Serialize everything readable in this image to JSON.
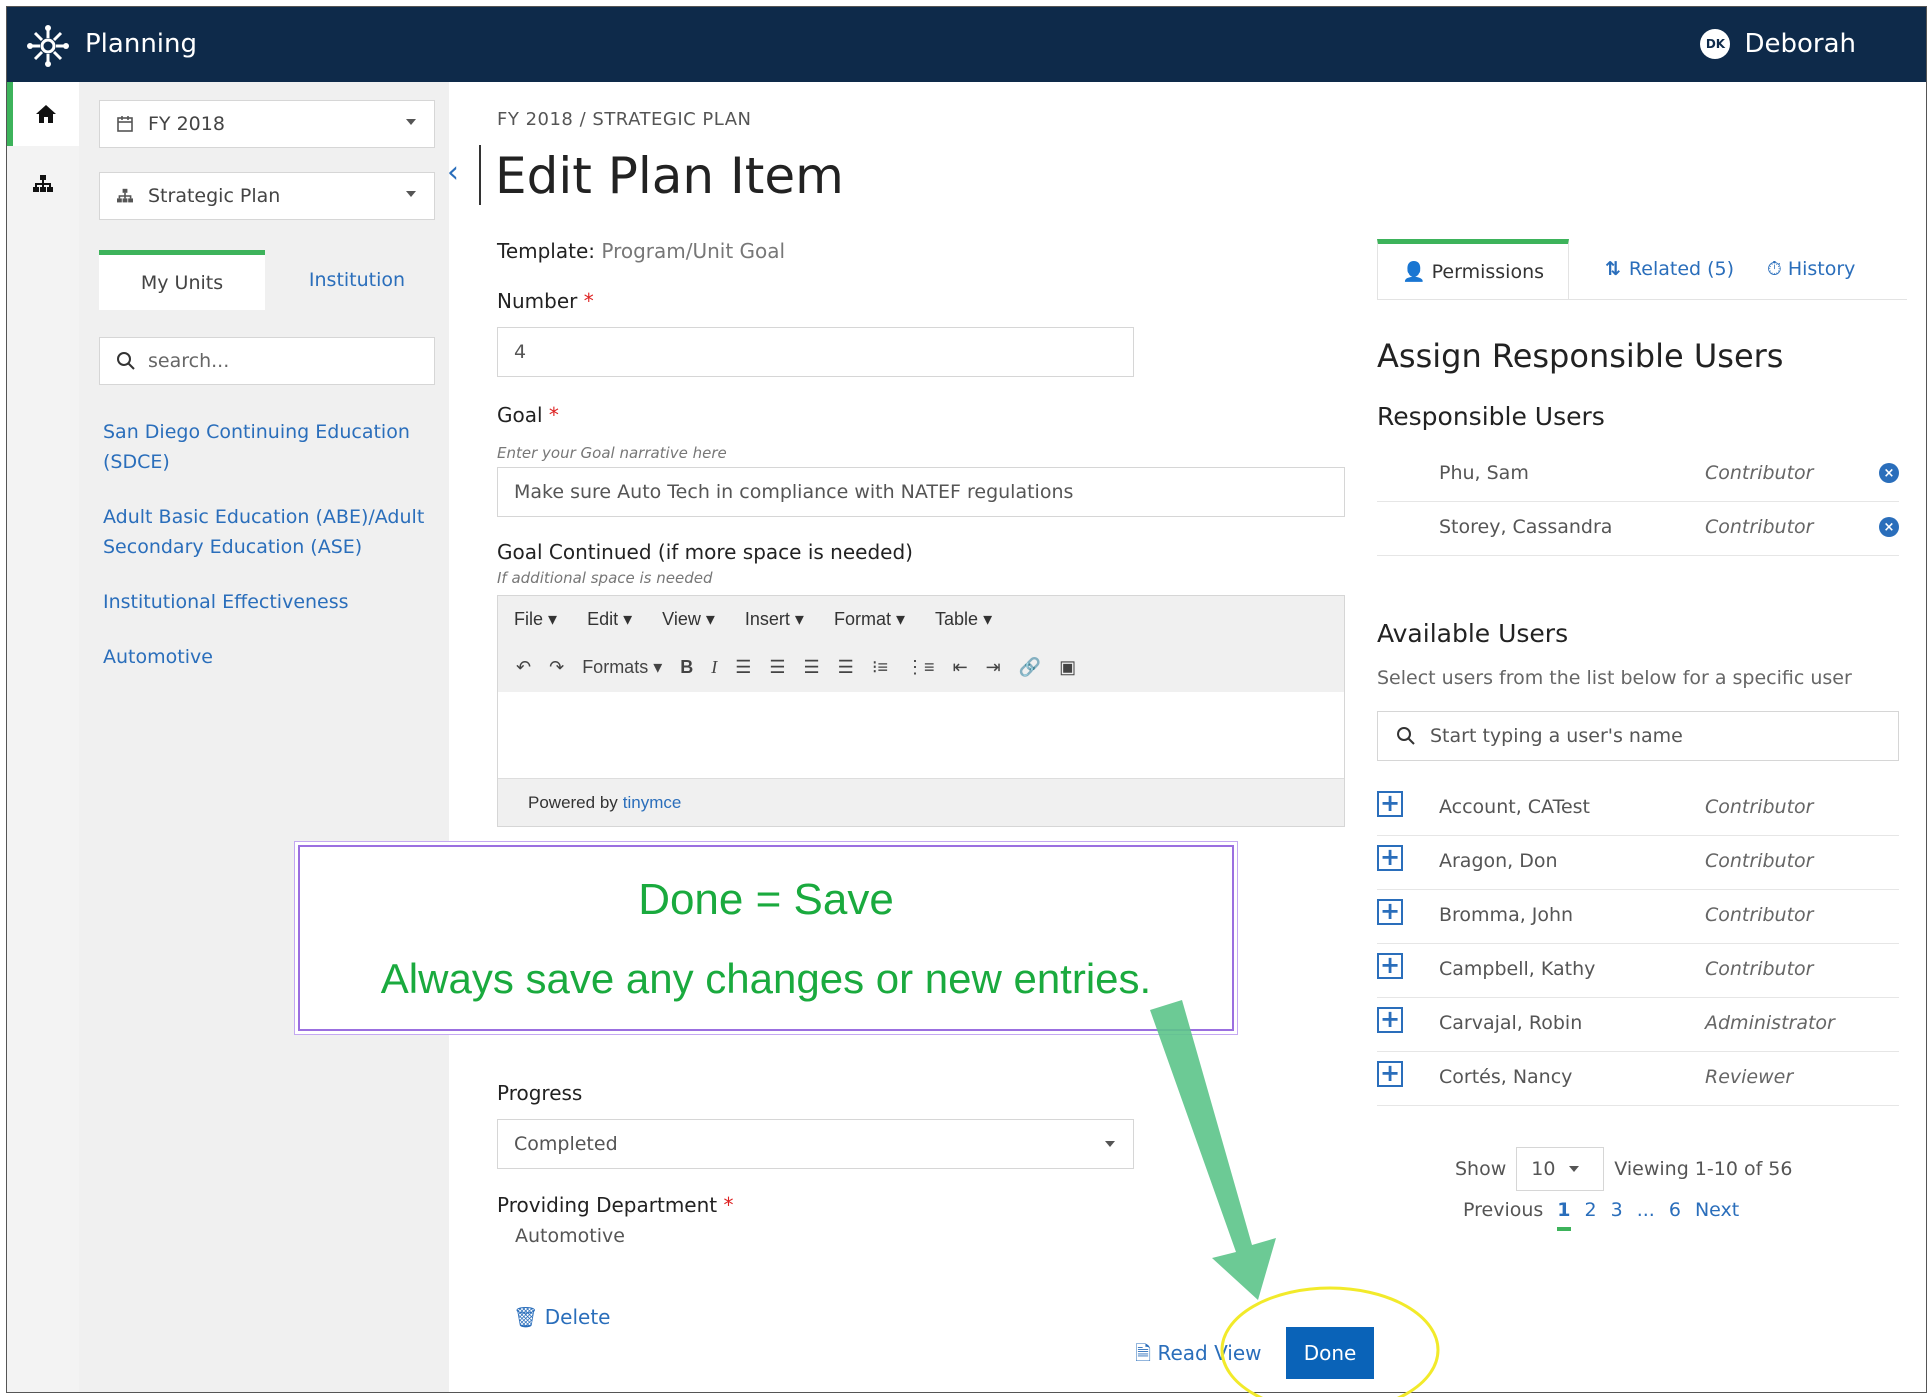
{
  "app": {
    "title": "Planning",
    "user_initials": "DK",
    "user_name": "Deborah"
  },
  "left": {
    "year_select": "FY 2018",
    "plan_select": "Strategic Plan",
    "tabs": [
      "My Units",
      "Institution"
    ],
    "search_placeholder": "search...",
    "units": [
      "San Diego Continuing Education (SDCE)",
      "Adult Basic Education (ABE)/Adult Secondary Education (ASE)",
      "Institutional Effectiveness",
      "Automotive"
    ]
  },
  "main": {
    "breadcrumb": "FY 2018 / STRATEGIC PLAN",
    "title": "Edit Plan Item",
    "template_label": "Template:",
    "template_value": "Program/Unit Goal",
    "number_label": "Number",
    "number_value": "4",
    "goal_label": "Goal",
    "goal_hint": "Enter your Goal narrative here",
    "goal_value": "Make sure Auto Tech in compliance with NATEF regulations",
    "goal_cont_label": "Goal Continued (if more space is needed)",
    "goal_cont_hint": "If additional space is needed",
    "editor_menu": [
      "File",
      "Edit",
      "View",
      "Insert",
      "Format",
      "Table"
    ],
    "editor_formats": "Formats",
    "editor_bold": "B",
    "editor_italic": "I",
    "powered_by": "Powered by",
    "powered_link": "tinymce",
    "progress_label": "Progress",
    "progress_value": "Completed",
    "dept_label": "Providing Department",
    "dept_value": "Automotive",
    "required_mark": "*",
    "delete_label": "Delete",
    "read_view_label": "Read View",
    "done_label": "Done"
  },
  "callout": {
    "line1": "Done = Save",
    "line2": "Always save any changes or new entries.",
    "arrow_color": "#5cc48a",
    "ellipse_color": "#f2ea2a"
  },
  "right": {
    "tab_permissions": "Permissions",
    "tab_related": "Related (5)",
    "tab_history": "History",
    "heading": "Assign Responsible Users",
    "responsible_heading": "Responsible Users",
    "responsible": [
      {
        "name": "Phu,  Sam",
        "role": "Contributor"
      },
      {
        "name": "Storey,  Cassandra",
        "role": "Contributor"
      }
    ],
    "available_heading": "Available Users",
    "available_hint": "Select users from the list below for a specific user",
    "search_placeholder": "Start typing a user's name",
    "available": [
      {
        "name": "Account,  CATest",
        "role": "Contributor"
      },
      {
        "name": "Aragon,  Don",
        "role": "Contributor"
      },
      {
        "name": "Bromma,  John",
        "role": "Contributor"
      },
      {
        "name": "Campbell,  Kathy",
        "role": "Contributor"
      },
      {
        "name": "Carvajal,  Robin",
        "role": "Administrator"
      },
      {
        "name": "Cortés,  Nancy",
        "role": "Reviewer"
      }
    ],
    "show_label": "Show",
    "page_size": "10",
    "viewing": "Viewing 1-10 of 56",
    "prev": "Previous",
    "pages": [
      "1",
      "2",
      "3",
      "...",
      "6"
    ],
    "next": "Next"
  },
  "colors": {
    "topbar": "#0e2a4a",
    "accent_green": "#3db35b",
    "link_blue": "#2a6ebb",
    "done_blue": "#0a63b8"
  }
}
